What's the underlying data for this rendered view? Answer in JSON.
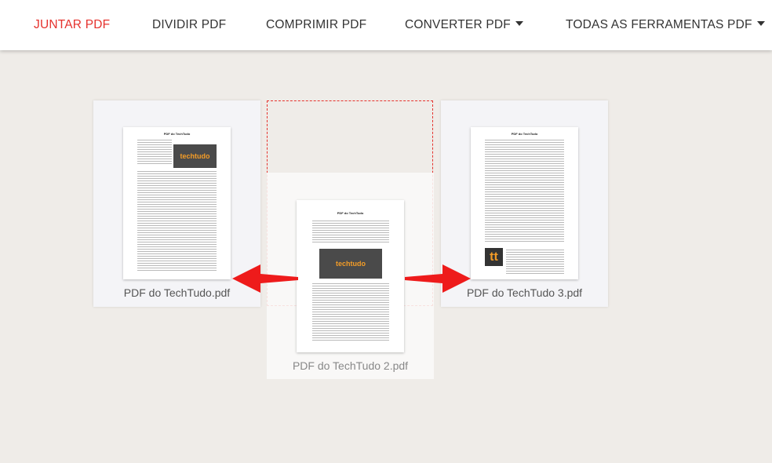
{
  "nav": {
    "items": [
      {
        "label": "JUNTAR PDF",
        "active": true,
        "dropdown": false
      },
      {
        "label": "DIVIDIR PDF",
        "active": false,
        "dropdown": false
      },
      {
        "label": "COMPRIMIR PDF",
        "active": false,
        "dropdown": false
      },
      {
        "label": "CONVERTER PDF",
        "active": false,
        "dropdown": true
      },
      {
        "label": "TODAS AS FERRAMENTAS PDF",
        "active": false,
        "dropdown": true
      }
    ]
  },
  "files": [
    {
      "name": "PDF do TechTudo.pdf",
      "doc_title": "PDF do TechTudo",
      "logo": "techtudo"
    },
    {
      "name": "PDF do TechTudo 2.pdf",
      "doc_title": "PDF do TechTudo",
      "logo": "techtudo",
      "dragging": true
    },
    {
      "name": "PDF do TechTudo 3.pdf",
      "doc_title": "PDF do TechTudo",
      "logo": "tt"
    }
  ],
  "colors": {
    "accent": "#e5322d",
    "logo_orange": "#f39c27",
    "background": "#efece8"
  },
  "icons": {
    "left_arrow": "arrow-left-icon",
    "right_arrow": "arrow-right-icon",
    "dropdown": "caret-down-icon"
  }
}
